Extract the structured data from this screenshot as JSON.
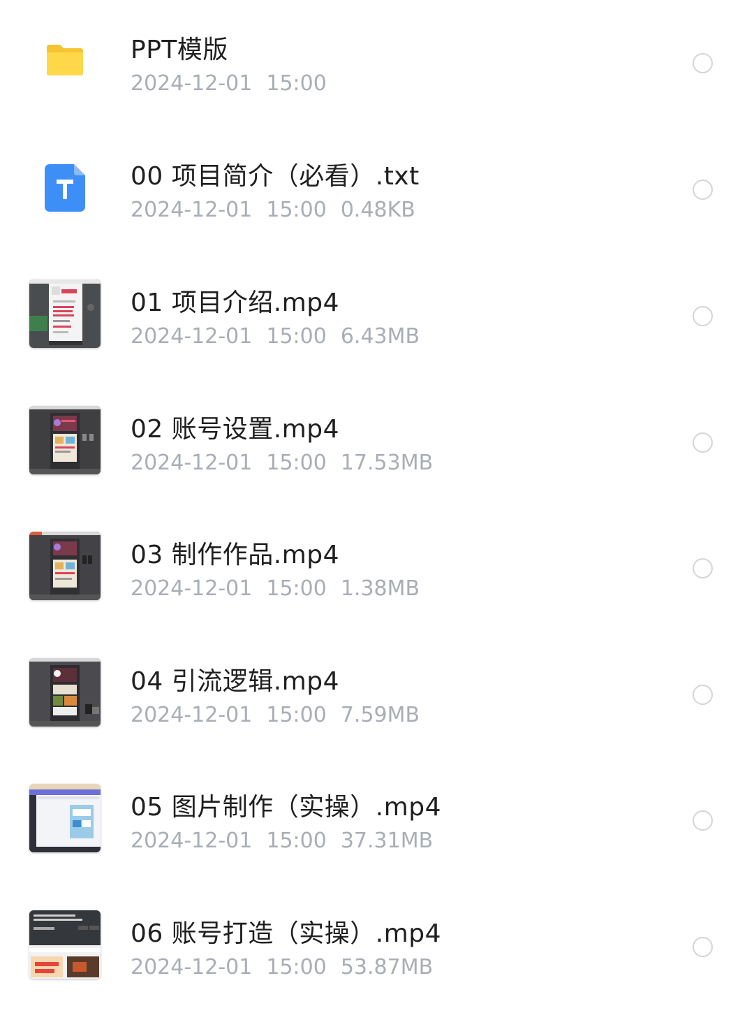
{
  "files": [
    {
      "name": "PPT模版",
      "date": "2024-12-01",
      "time": "15:00",
      "size": null,
      "icon": "folder-icon",
      "thumb": "folder",
      "accent": "#FFD43B"
    },
    {
      "name": "00 项目简介（必看）.txt",
      "date": "2024-12-01",
      "time": "15:00",
      "size": "0.48KB",
      "icon": "text-file-icon",
      "thumb": "txt",
      "accent": "#3E8EF7"
    },
    {
      "name": "01 项目介绍.mp4",
      "date": "2024-12-01",
      "time": "15:00",
      "size": "6.43MB",
      "icon": "video-thumbnail-icon",
      "thumb": "dark-doc"
    },
    {
      "name": "02 账号设置.mp4",
      "date": "2024-12-01",
      "time": "15:00",
      "size": "17.53MB",
      "icon": "video-thumbnail-icon",
      "thumb": "dark-phone"
    },
    {
      "name": "03 制作作品.mp4",
      "date": "2024-12-01",
      "time": "15:00",
      "size": "1.38MB",
      "icon": "video-thumbnail-icon",
      "thumb": "dark-phone"
    },
    {
      "name": "04 引流逻辑.mp4",
      "date": "2024-12-01",
      "time": "15:00",
      "size": "7.59MB",
      "icon": "video-thumbnail-icon",
      "thumb": "dark-phone2"
    },
    {
      "name": "05 图片制作（实操）.mp4",
      "date": "2024-12-01",
      "time": "15:00",
      "size": "37.31MB",
      "icon": "video-thumbnail-icon",
      "thumb": "light-editor"
    },
    {
      "name": "06 账号打造（实操）.mp4",
      "date": "2024-12-01",
      "time": "15:00",
      "size": "53.87MB",
      "icon": "video-thumbnail-icon",
      "thumb": "social"
    }
  ]
}
